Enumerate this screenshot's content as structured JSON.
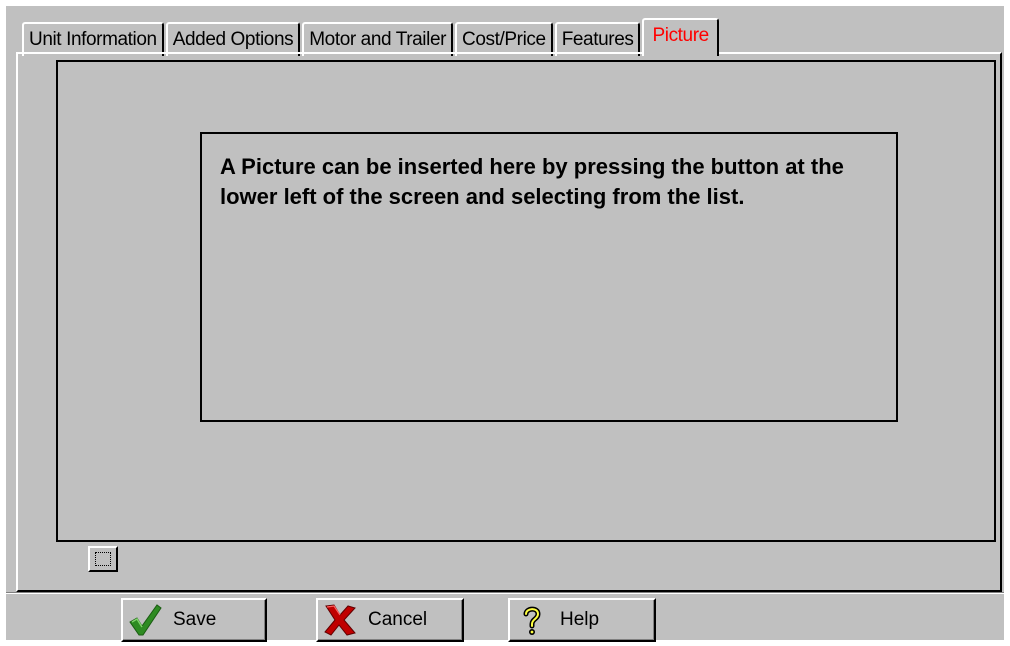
{
  "tabs": [
    {
      "label": "Unit Information"
    },
    {
      "label": "Added Options"
    },
    {
      "label": "Motor and Trailer"
    },
    {
      "label": "Cost/Price"
    },
    {
      "label": "Features"
    },
    {
      "label": "Picture",
      "active": true
    }
  ],
  "picture_panel": {
    "info_text": "A Picture can be inserted here by pressing the button at the lower left of the screen and selecting from the list."
  },
  "buttons": {
    "save": "Save",
    "cancel": "Cancel",
    "help": "Help"
  },
  "colors": {
    "face": "#c0c0c0",
    "active_tab_text": "#ff0000",
    "save_icon": "#2e8b22",
    "cancel_icon": "#c00000"
  },
  "icons": {
    "save": "green-checkmark-icon",
    "cancel": "red-x-icon",
    "help": "question-mark-icon",
    "picture": "dotted-frame-icon"
  }
}
